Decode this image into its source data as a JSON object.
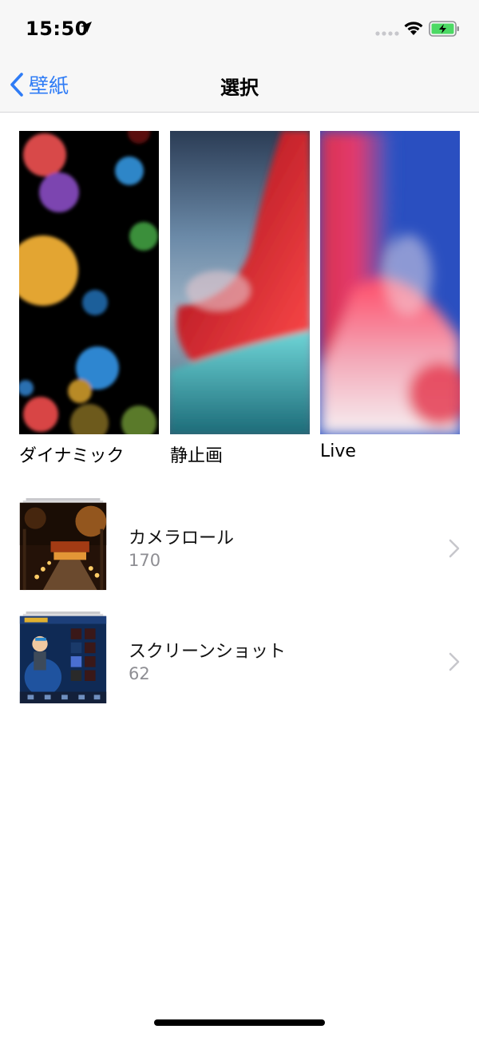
{
  "status_bar": {
    "time": "15:50"
  },
  "nav": {
    "back_label": "壁紙",
    "title": "選択"
  },
  "wallpapers": [
    {
      "label": "ダイナミック"
    },
    {
      "label": "静止画"
    },
    {
      "label": "Live"
    }
  ],
  "albums": [
    {
      "title": "カメラロール",
      "count": "170"
    },
    {
      "title": "スクリーンショット",
      "count": "62"
    }
  ],
  "colors": {
    "accent": "#2f7cf6",
    "secondary_text": "#8e8e93",
    "bar_background": "#f7f7f7",
    "battery_fill": "#4cd964"
  },
  "icons": [
    "location-arrow-icon",
    "cellular-signal-icon",
    "wifi-icon",
    "battery-charging-icon",
    "back-chevron-icon",
    "disclosure-chevron-icon"
  ]
}
